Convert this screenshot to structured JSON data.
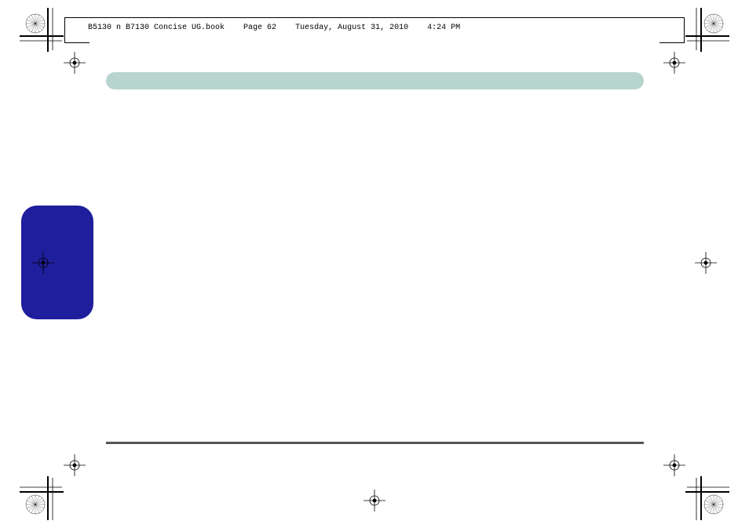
{
  "slug": {
    "filename": "B5130 n B7130 Concise UG.book",
    "page_label": "Page 62",
    "date": "Tuesday, August 31, 2010",
    "time": "4:24 PM"
  },
  "colors": {
    "teal_header": "#b8d4ce",
    "sidebar_tab": "#1f1e9c",
    "footer_rule": "#555555"
  }
}
